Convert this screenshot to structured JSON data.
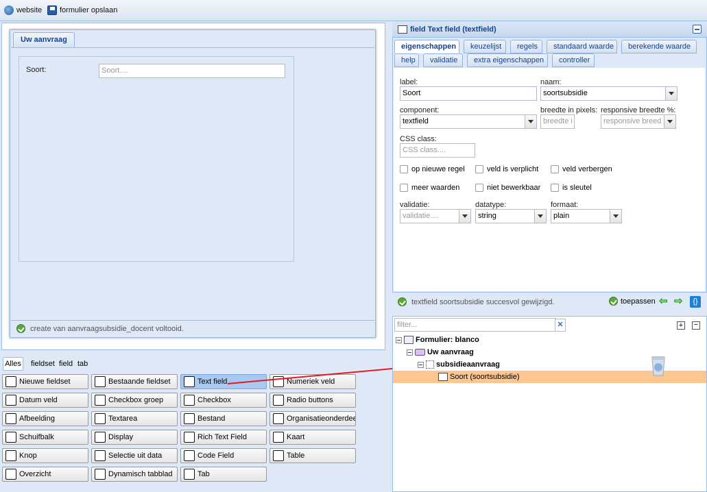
{
  "toolbar": {
    "website_label": "website",
    "save_label": "formulier opslaan"
  },
  "preview": {
    "tab_label": "Uw aanvraag",
    "field_label": "Soort:",
    "field_placeholder": "Soort....",
    "status": "create van aanvraagsubsidie_docent voltooid."
  },
  "palette": {
    "filters": [
      "Alles",
      "fieldset",
      "field",
      "tab"
    ],
    "buttons": [
      {
        "label": "Nieuwe fieldset",
        "icon": "list-icon"
      },
      {
        "label": "Bestaande fieldset",
        "icon": "list-icon"
      },
      {
        "label": "Text field",
        "icon": "textfield-icon",
        "selected": true
      },
      {
        "label": "Numeriek veld",
        "icon": "textfield-icon"
      },
      {
        "label": "Datum veld",
        "icon": "calendar-icon"
      },
      {
        "label": "Checkbox groep",
        "icon": "checklist-icon"
      },
      {
        "label": "Checkbox",
        "icon": "checkbox-icon"
      },
      {
        "label": "Radio buttons",
        "icon": "radio-icon"
      },
      {
        "label": "Afbeelding",
        "icon": "image-icon"
      },
      {
        "label": "Textarea",
        "icon": "textarea-icon"
      },
      {
        "label": "Bestand",
        "icon": "paperclip-icon"
      },
      {
        "label": "Organisatieonderdeel",
        "icon": "org-icon"
      },
      {
        "label": "Schuifbalk",
        "icon": "slider-icon"
      },
      {
        "label": "Display",
        "icon": "text-icon"
      },
      {
        "label": "Rich Text Field",
        "icon": "code-icon"
      },
      {
        "label": "Kaart",
        "icon": "globe-icon"
      },
      {
        "label": "Knop",
        "icon": "button-icon"
      },
      {
        "label": "Selectie uit data",
        "icon": "database-icon"
      },
      {
        "label": "Code Field",
        "icon": "braces-icon"
      },
      {
        "label": "Table",
        "icon": "table-icon"
      },
      {
        "label": "Overzicht",
        "icon": "table-icon"
      },
      {
        "label": "Dynamisch tabblad",
        "icon": "tab-add-icon"
      },
      {
        "label": "Tab",
        "icon": "tab-add-icon"
      }
    ]
  },
  "props": {
    "title": "field Text field (textfield)",
    "tabs_row1": [
      "eigenschappen",
      "keuzelijst",
      "regels",
      "standaard waarde",
      "berekende waarde"
    ],
    "tabs_row2": [
      "help",
      "validatie",
      "extra eigenschappen",
      "controller"
    ],
    "label_caption": "label:",
    "label_value": "Soort",
    "naam_caption": "naam:",
    "naam_value": "soortsubsidie",
    "component_caption": "component:",
    "component_value": "textfield",
    "breedte_caption": "breedte in pixels:",
    "breedte_placeholder": "breedte i",
    "resp_caption": "responsive breedte %:",
    "resp_placeholder": "responsive breed",
    "css_caption": "CSS class:",
    "css_placeholder": "CSS class....",
    "checks": [
      "op nieuwe regel",
      "veld is verplicht",
      "veld verbergen",
      "meer waarden",
      "niet bewerkbaar",
      "is sleutel"
    ],
    "validatie_caption": "validatie:",
    "validatie_placeholder": "validatie....",
    "datatype_caption": "datatype:",
    "datatype_value": "string",
    "formaat_caption": "formaat:",
    "formaat_value": "plain",
    "status": "textfield soortsubsidie succesvol gewijzigd.",
    "apply_label": "toepassen"
  },
  "tree": {
    "filter_placeholder": "filter...",
    "nodes": [
      "Formulier: blanco",
      "Uw aanvraag",
      "subsidieaanvraag",
      "Soort (soortsubsidie)"
    ]
  }
}
